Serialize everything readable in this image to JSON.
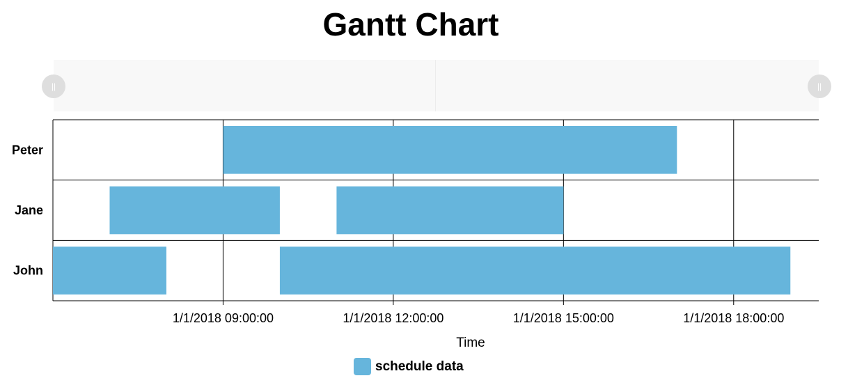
{
  "chart_data": {
    "type": "bar",
    "subtype": "gantt",
    "title": "Gantt Chart",
    "xlabel": "Time",
    "ylabel": "",
    "x_axis_type": "datetime",
    "xlim": [
      "1/1/2018 06:00:00",
      "1/1/2018 19:30:00"
    ],
    "x_ticks": [
      "1/1/2018 09:00:00",
      "1/1/2018 12:00:00",
      "1/1/2018 15:00:00",
      "1/1/2018 18:00:00"
    ],
    "categories": [
      "Peter",
      "Jane",
      "John"
    ],
    "grid": true,
    "legend_position": "bottom",
    "series": [
      {
        "name": "schedule data",
        "color": "#66b5dc",
        "tasks": [
          {
            "category": "Peter",
            "start": "1/1/2018 09:00:00",
            "end": "1/1/2018 17:00:00"
          },
          {
            "category": "Jane",
            "start": "1/1/2018 07:00:00",
            "end": "1/1/2018 10:00:00"
          },
          {
            "category": "Jane",
            "start": "1/1/2018 11:00:00",
            "end": "1/1/2018 15:00:00"
          },
          {
            "category": "John",
            "start": "1/1/2018 06:00:00",
            "end": "1/1/2018 08:00:00"
          },
          {
            "category": "John",
            "start": "1/1/2018 10:00:00",
            "end": "1/1/2018 19:00:00"
          }
        ]
      }
    ]
  },
  "zoom_slider": {
    "handle_icon": "grip-icon",
    "handle_color": "#dedede"
  }
}
